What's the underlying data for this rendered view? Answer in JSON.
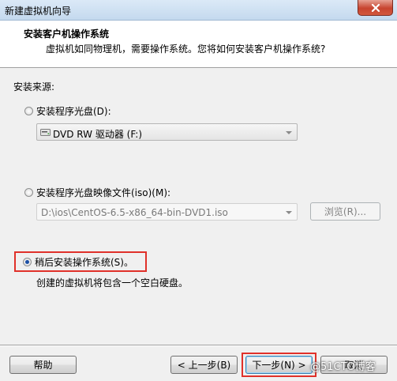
{
  "window": {
    "title": "新建虚拟机向导"
  },
  "header": {
    "title": "安装客户机操作系统",
    "subtitle": "虚拟机如同物理机，需要操作系统。您将如何安装客户机操作系统?"
  },
  "source": {
    "label": "安装来源:",
    "disc_option": "安装程序光盘(D):",
    "disc_value": "DVD RW 驱动器 (F:)",
    "iso_option": "安装程序光盘映像文件(iso)(M):",
    "iso_value": "D:\\ios\\CentOS-6.5-x86_64-bin-DVD1.iso",
    "browse_label": "浏览(R)...",
    "later_option": "稍后安装操作系统(S)。",
    "later_desc": "创建的虚拟机将包含一个空白硬盘。",
    "selected": "later"
  },
  "footer": {
    "help_label": "帮助",
    "back_label": "< 上一步(B)",
    "next_label": "下一步(N) >",
    "cancel_label": "取消"
  },
  "watermark": "@51CTO博客",
  "colors": {
    "highlight": "#e0312a",
    "header_bg": "#ffffff",
    "dialog_bg": "#f0f0f0"
  }
}
